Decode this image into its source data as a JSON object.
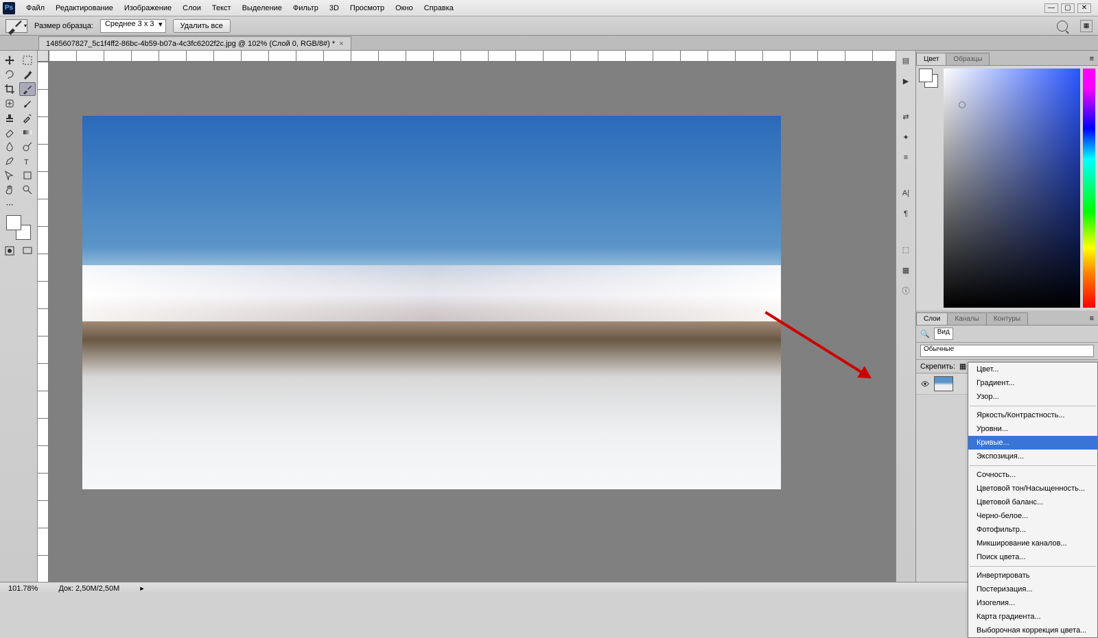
{
  "app": {
    "logo": "Ps"
  },
  "menus": [
    "Файл",
    "Редактирование",
    "Изображение",
    "Слои",
    "Текст",
    "Выделение",
    "Фильтр",
    "3D",
    "Просмотр",
    "Окно",
    "Справка"
  ],
  "options": {
    "size_label": "Размер образца:",
    "size_value": "Среднее 3 x 3",
    "clear_all": "Удалить все"
  },
  "document": {
    "tab_title": "1485607827_5c1f4ff2-86bc-4b59-b07a-4c3fc6202f2c.jpg @ 102% (Слой 0, RGB/8#) *"
  },
  "panels": {
    "color_tab": "Цвет",
    "swatches_tab": "Образцы",
    "layers_tab": "Слои",
    "channels_tab": "Каналы",
    "paths_tab": "Контуры",
    "search_label": "Вид",
    "blend_mode": "Обычные",
    "lock_label": "Скрепить:"
  },
  "adjustment_menu": {
    "group1": [
      "Цвет...",
      "Градиент...",
      "Узор..."
    ],
    "group2": [
      "Яркость/Контрастность...",
      "Уровни...",
      "Кривые...",
      "Экспозиция..."
    ],
    "group3": [
      "Сочность...",
      "Цветовой тон/Насыщенность...",
      "Цветовой баланс...",
      "Черно-белое...",
      "Фотофильтр...",
      "Микширование каналов...",
      "Поиск цвета..."
    ],
    "group4": [
      "Инвертировать",
      "Постеризация...",
      "Изогелия...",
      "Карта градиента...",
      "Выборочная коррекция цвета..."
    ],
    "highlighted": "Кривые..."
  },
  "status": {
    "zoom": "101.78%",
    "doc": "Док: 2,50M/2,50M"
  }
}
